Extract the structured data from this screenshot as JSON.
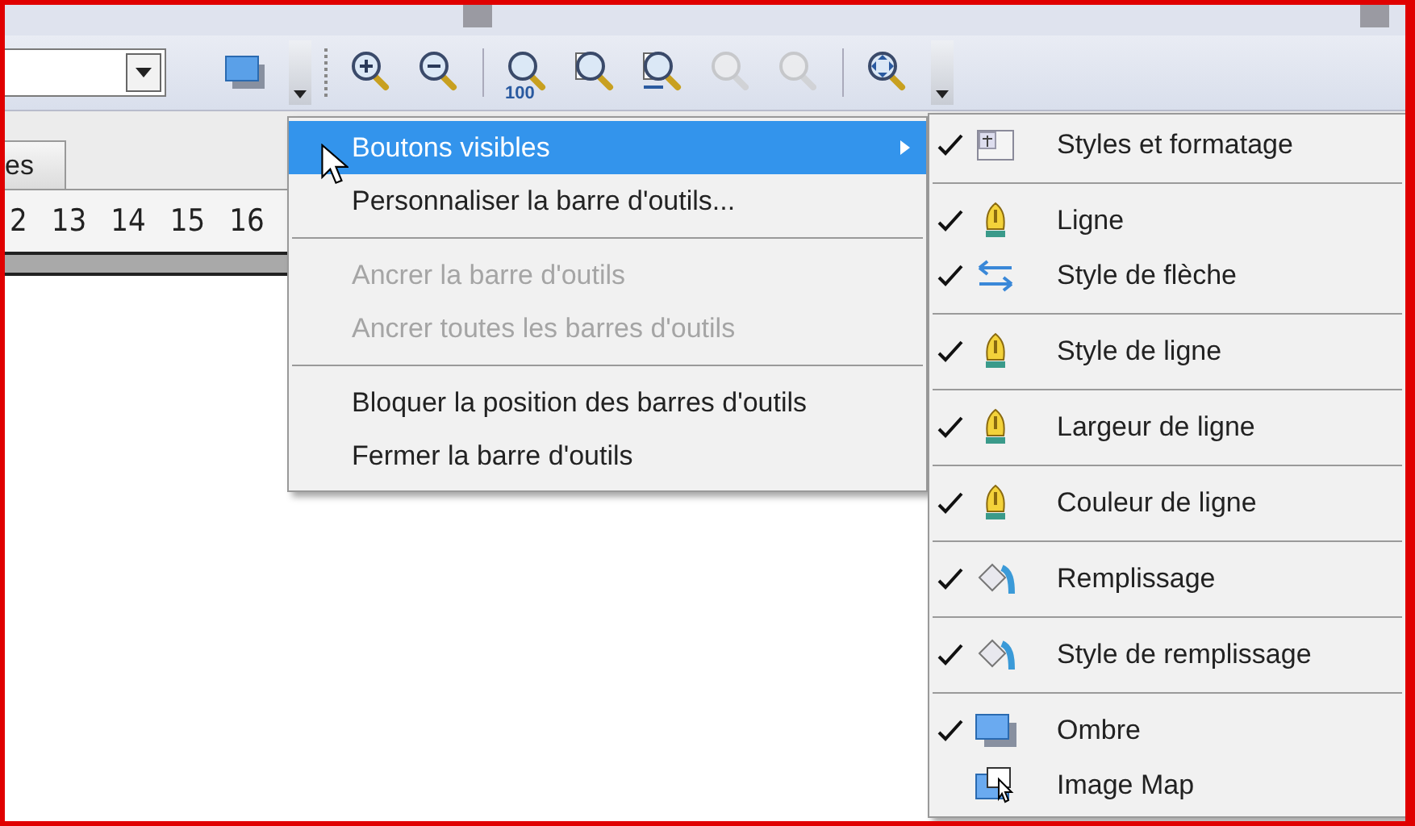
{
  "toolbar": {
    "tools": [
      {
        "kind": "zoom-in",
        "disabled": false
      },
      {
        "kind": "zoom-out",
        "disabled": false
      },
      {
        "kind": "zoom-100",
        "disabled": false,
        "badge": "100"
      },
      {
        "kind": "zoom-page",
        "disabled": false
      },
      {
        "kind": "zoom-width",
        "disabled": false
      },
      {
        "kind": "zoom-prev",
        "disabled": true
      },
      {
        "kind": "zoom-next",
        "disabled": true
      },
      {
        "kind": "zoom-pan",
        "disabled": false
      }
    ]
  },
  "tab": {
    "label": "es"
  },
  "ruler": [
    "2",
    "13",
    "14",
    "15",
    "16"
  ],
  "context_menu": {
    "groups": [
      [
        {
          "label": "Boutons visibles",
          "selected": true,
          "disabled": false,
          "submenu": true
        },
        {
          "label": "Personnaliser la barre d'outils...",
          "selected": false,
          "disabled": false,
          "submenu": false
        }
      ],
      [
        {
          "label": "Ancrer la barre d'outils",
          "selected": false,
          "disabled": true,
          "submenu": false
        },
        {
          "label": "Ancrer toutes les barres d'outils",
          "selected": false,
          "disabled": true,
          "submenu": false
        }
      ],
      [
        {
          "label": "Bloquer la position des barres d'outils",
          "selected": false,
          "disabled": false,
          "submenu": false
        },
        {
          "label": "Fermer la barre d'outils",
          "selected": false,
          "disabled": false,
          "submenu": false
        }
      ]
    ]
  },
  "submenu": {
    "groups": [
      [
        {
          "label": "Styles et formatage",
          "checked": true,
          "kind": "styles"
        }
      ],
      [
        {
          "label": "Ligne",
          "checked": true,
          "kind": "pen"
        },
        {
          "label": "Style de flèche",
          "checked": true,
          "kind": "arrows"
        }
      ],
      [
        {
          "label": "Style de ligne",
          "checked": true,
          "kind": "pen"
        }
      ],
      [
        {
          "label": "Largeur de ligne",
          "checked": true,
          "kind": "pen"
        }
      ],
      [
        {
          "label": "Couleur de ligne",
          "checked": true,
          "kind": "pen"
        }
      ],
      [
        {
          "label": "Remplissage",
          "checked": true,
          "kind": "bucket"
        }
      ],
      [
        {
          "label": "Style de remplissage",
          "checked": true,
          "kind": "bucket"
        }
      ],
      [
        {
          "label": "Ombre",
          "checked": true,
          "kind": "shadow"
        },
        {
          "label": "Image Map",
          "checked": false,
          "kind": "imagemap"
        }
      ]
    ]
  }
}
